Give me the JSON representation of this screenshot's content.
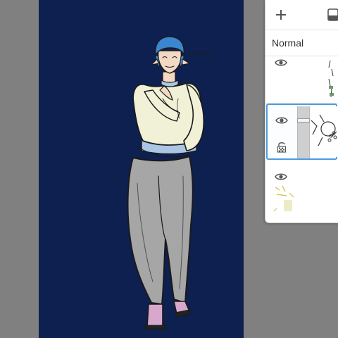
{
  "canvas": {
    "background_color": "#0e2050",
    "scribble_text": "Hi bride...",
    "character": {
      "hair_color": "#3a86d1",
      "skin_color": "#f3d9c4",
      "sweater_color": "#f1f1d8",
      "waistband_color": "#aac6e4",
      "pants_color": "#a6a6a6",
      "shoes_color": "#d8a8cc"
    }
  },
  "layers_panel": {
    "toolbar": {
      "add_icon": "plus-icon",
      "mask_icon": "layer-mask-icon"
    },
    "blend_mode": {
      "value": "Normal"
    },
    "layers": [
      {
        "visible": true,
        "selected": false,
        "icon": "eye-icon"
      },
      {
        "visible": true,
        "selected": true,
        "icon": "eye-icon",
        "lock_icon": "alpha-lock-icon",
        "opacity": 0.75
      },
      {
        "visible": true,
        "selected": false,
        "icon": "eye-icon"
      }
    ],
    "accent_color": "#4a9de0"
  }
}
